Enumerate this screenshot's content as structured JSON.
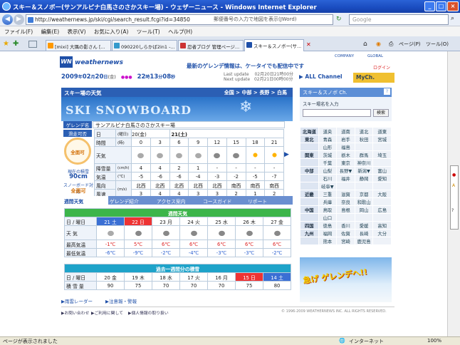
{
  "window": {
    "title": "スキー＆スノボー(サンアルピナ白馬さのさかスキー場) - ウェザーニュース - Windows Internet Explorer",
    "min": "_",
    "max": "□",
    "close": "×"
  },
  "address": {
    "url": "http://weathernews.jp/ski/cgi/search_result.fcgi?id=34850",
    "placeholder": "郵便番号の入力で地図を表示(JWord)",
    "search_placeholder": "Google"
  },
  "menu": [
    "ファイル(F)",
    "編集(E)",
    "表示(V)",
    "お気に入り(A)",
    "ツール(T)",
    "ヘルプ(H)"
  ],
  "tabs": [
    "[mixi] 大隅の影さん [...",
    "090220しらかば2in1 -...",
    "忍者ブログ 管理ページ...",
    "スキー＆スノボー(サ..."
  ],
  "toolbar": {
    "page": "ページ(P)",
    "tools": "ツール(O)"
  },
  "site": {
    "brand": "weathernews",
    "brand_short": "WN",
    "company": "COMPANY",
    "global": "GLOBAL",
    "login": "ログイン",
    "promo": "最新のゲレンデ情報は、ケータイでも配信中です",
    "date_parts": [
      "2009",
      "年",
      "02",
      "月",
      "20",
      "日",
      "(金)",
      "22",
      "時",
      "13",
      "分",
      "08",
      "秒"
    ],
    "last_update_label": "Last update",
    "last_update": "02月20日21時00分",
    "next_update_label": "Next update",
    "next_update": "02月21日00時00分",
    "all_channel": "ALL Channel",
    "mych": "MyCh."
  },
  "main": {
    "section_title": "スキー場の天気",
    "breadcrumb": [
      "全国",
      "中部",
      "長野",
      "白馬"
    ],
    "banner_text": "SKI SNOWBOARD",
    "resort_label": "ゲレンデ名",
    "resort_name": "サンアルピナ白馬さのさかスキー場",
    "status_label": "滑走可否",
    "status_value": "全面可",
    "snow_label": "現在の積雪",
    "snow_value": "90cm",
    "snowboard_label": "スノーボード対応",
    "snowboard_value": "全面可",
    "hourly": {
      "rows": [
        "日",
        "時間",
        "天気",
        "降雪量",
        "気温",
        "風向",
        "風速"
      ],
      "units": [
        "(曜日)",
        "(時)",
        "",
        "(cm/h)",
        "(℃)",
        "",
        ""
      ],
      "days": [
        "20(金)",
        "21(土)"
      ],
      "hours": [
        "0",
        "3",
        "6",
        "9",
        "12",
        "15",
        "18",
        "21"
      ],
      "weather_icons": [
        "snow",
        "snow",
        "snow",
        "snow",
        "cloud",
        "cloud",
        "sun",
        "sun"
      ],
      "snowfall": [
        "4",
        "4",
        "2",
        "1",
        "-",
        "-",
        "-",
        "-"
      ],
      "temp": [
        "-5",
        "-6",
        "-6",
        "-4",
        "-3",
        "-2",
        "-5",
        "-7"
      ],
      "wind_dir": [
        "北西",
        "北西",
        "北西",
        "北西",
        "北西",
        "南西",
        "南西",
        "南西"
      ],
      "wind_speed": [
        "3",
        "4",
        "4",
        "3",
        "3",
        "2",
        "1",
        "2"
      ],
      "wind_unit": "(m/s)"
    },
    "tabs": [
      "週間天気",
      "ゲレンデ紹介",
      "アクセス案内",
      "コースガイド",
      "リポート"
    ],
    "weekly": {
      "title": "週間天気",
      "row_labels": [
        "日 / 曜日",
        "天 気",
        "最高気温",
        "最低気温"
      ],
      "days": [
        "21 土",
        "22 日",
        "23 月",
        "24 火",
        "25 水",
        "26 木",
        "27 金"
      ],
      "weather_icons": [
        "snow",
        "cloud",
        "cloud",
        "cloud",
        "cloud",
        "cloud",
        "cloud"
      ],
      "high": [
        "-1℃",
        "5℃",
        "6℃",
        "6℃",
        "6℃",
        "6℃",
        "6℃"
      ],
      "low": [
        "-6℃",
        "-9℃",
        "-2℃",
        "-4℃",
        "-3℃",
        "-3℃",
        "-2℃"
      ]
    },
    "past": {
      "title": "過去一週間分の積雪",
      "row_labels": [
        "日 / 曜日",
        "積 雪 量"
      ],
      "days": [
        "20 金",
        "19 木",
        "18 水",
        "17 火",
        "16 月",
        "15 日",
        "14 土"
      ],
      "values": [
        "90",
        "75",
        "70",
        "70",
        "70",
        "75",
        "80"
      ]
    },
    "links": [
      "雨雲レーダー",
      "注意報・警報"
    ],
    "footer_links": [
      "お問い合わせ",
      "ご利用に関して",
      "個人情報の取り扱い"
    ],
    "copyright": "© 1996-2009 WEATHERNEWS INC. ALL RIGHTS RESERVED."
  },
  "sidebar": {
    "title": "スキー＆スノボ Ch.",
    "search_label": "スキー場名を入力",
    "search_button": "検索",
    "regions": [
      [
        "北海道",
        "道央",
        "道南",
        "道北",
        "道東"
      ],
      [
        "東北",
        "青森",
        "岩手",
        "秋田",
        "宮城"
      ],
      [
        "",
        "山形",
        "福島",
        "",
        ""
      ],
      [
        "関東",
        "茨城",
        "栃木",
        "群馬",
        "埼玉"
      ],
      [
        "",
        "千葉",
        "東京",
        "神奈川",
        ""
      ],
      [
        "中部",
        "山梨",
        "長野▼",
        "新潟▼",
        "富山"
      ],
      [
        "",
        "石川",
        "福井",
        "静岡",
        "愛知"
      ],
      [
        "",
        "岐阜▼",
        "",
        "",
        ""
      ],
      [
        "近畿",
        "三重",
        "滋賀",
        "京都",
        "大阪"
      ],
      [
        "",
        "兵庫",
        "奈良",
        "和歌山",
        ""
      ],
      [
        "中国",
        "鳥取",
        "島根",
        "岡山",
        "広島"
      ],
      [
        "",
        "山口",
        "",
        "",
        ""
      ],
      [
        "四国",
        "徳島",
        "香川",
        "愛媛",
        "高知"
      ],
      [
        "九州",
        "福岡",
        "佐賀",
        "長崎",
        "大分"
      ],
      [
        "",
        "熊本",
        "宮崎",
        "鹿児島",
        ""
      ]
    ],
    "ad_text": "急げ ゲレンデへ!!"
  },
  "status": {
    "text": "ページが表示されました",
    "zone": "インターネット",
    "zoom": "100%"
  }
}
